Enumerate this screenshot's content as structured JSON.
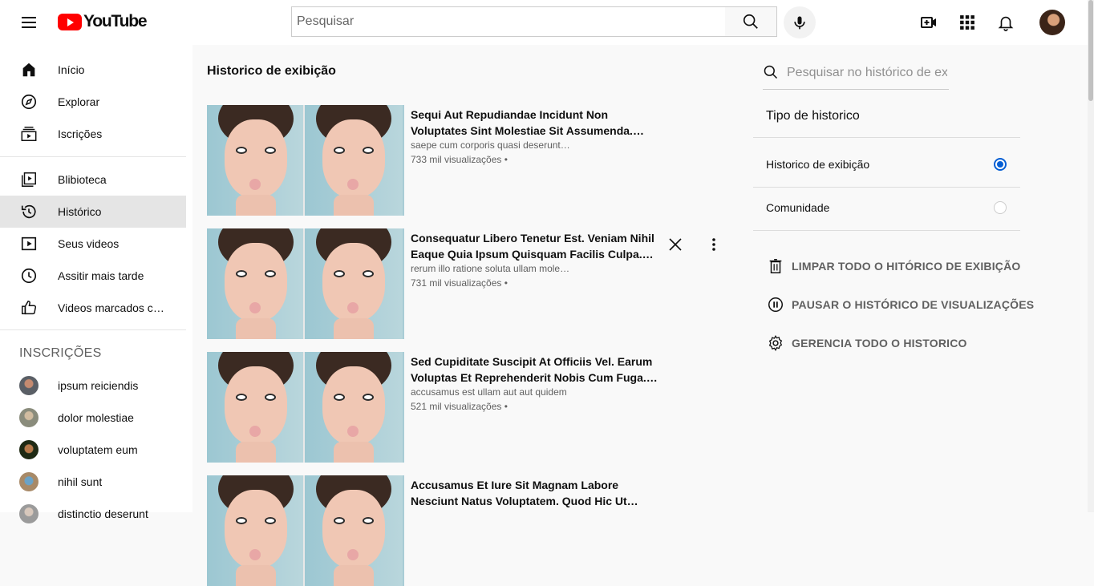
{
  "header": {
    "logo_text": "YouTube",
    "search_placeholder": "Pesquisar"
  },
  "sidebar": {
    "items": [
      {
        "label": "Início",
        "icon": "home-icon"
      },
      {
        "label": "Explorar",
        "icon": "compass-icon"
      },
      {
        "label": "Iscrições",
        "icon": "subscriptions-icon"
      },
      {
        "label": "Blibioteca",
        "icon": "library-icon"
      },
      {
        "label": "Histórico",
        "icon": "history-icon",
        "active": true
      },
      {
        "label": "Seus videos",
        "icon": "play-icon"
      },
      {
        "label": "Assitir mais tarde",
        "icon": "clock-icon"
      },
      {
        "label": "Videos marcados com gostei",
        "icon": "thumbs-up-icon"
      }
    ],
    "subscriptions_title": "INSCRIÇÕES",
    "subscriptions": [
      {
        "name": "ipsum reiciendis",
        "color": "#5a5f66"
      },
      {
        "name": "dolor molestiae",
        "color": "#8a8c7c"
      },
      {
        "name": "voluptatem eum",
        "color": "#2b3a1f"
      },
      {
        "name": "nihil sunt",
        "color": "#a88a68"
      },
      {
        "name": "distinctio deserunt",
        "color": "#9b9b9b"
      }
    ]
  },
  "main": {
    "title": "Historico de exibição",
    "videos": [
      {
        "title": "Sequi Aut Repudiandae Incidunt Non Voluptates Sint Molestiae Sit Assumenda. Voluptas Dolor.",
        "desc": "saepe cum corporis quasi deserunt voluptatem",
        "views": "733 mil visualizações •"
      },
      {
        "title": "Consequatur Libero Tenetur Est. Veniam Nihil Eaque Quia Ipsum Quisquam Facilis Culpa. Quia.",
        "desc": "rerum illo ratione soluta ullam molestiae",
        "views": "731 mil visualizações •"
      },
      {
        "title": "Sed Cupiditate Suscipit At Officiis Vel. Earum Voluptas Et Reprehenderit Nobis Cum Fuga. Quia.",
        "desc": "accusamus est ullam aut aut quidem",
        "views": "521 mil visualizações •"
      },
      {
        "title": "Accusamus Et Iure Sit Magnam Labore Nesciunt Natus Voluptatem. Quod Hic Ut Cupiditate. Quia.",
        "desc": "",
        "views": ""
      }
    ]
  },
  "right": {
    "search_placeholder": "Pesquisar no histórico de exibição",
    "type_title": "Tipo de historico",
    "options": [
      {
        "label": "Historico de exibição",
        "selected": true
      },
      {
        "label": "Comunidade",
        "selected": false
      }
    ],
    "actions": [
      {
        "label": "LIMPAR TODO O HITÓRICO DE EXIBIÇÃO",
        "icon": "trash-icon"
      },
      {
        "label": "PAUSAR O HISTÓRICO DE VISUALIZAÇÕES",
        "icon": "pause-icon"
      },
      {
        "label": "GERENCIA TODO O HISTORICO",
        "icon": "gear-icon"
      }
    ]
  },
  "colors": {
    "brand_red": "#ff0000",
    "accent_blue": "#065fd4",
    "active_bg": "#e5e5e5"
  }
}
